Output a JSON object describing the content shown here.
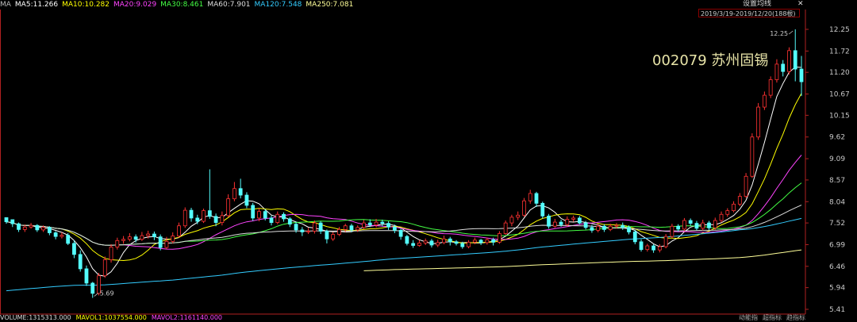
{
  "header": {
    "ma_indicators": [
      {
        "label": "MA",
        "color": "#bbbbbb"
      },
      {
        "label": "MA5:11.266",
        "color": "#ffffff"
      },
      {
        "label": "MA10:10.282",
        "color": "#ffff00"
      },
      {
        "label": "MA20:9.029",
        "color": "#ff44ff"
      },
      {
        "label": "MA30:8.461",
        "color": "#44ff44"
      },
      {
        "label": "MA60:7.901",
        "color": "#dddddd"
      },
      {
        "label": "MA120:7.548",
        "color": "#33ccff"
      },
      {
        "label": "MA250:7.081",
        "color": "#ffff99"
      }
    ],
    "settings_label": "设置均线",
    "range_label": "2019/3/19-2019/12/20(188根)"
  },
  "stock_label": "002079 苏州固锡",
  "volume_bar": [
    {
      "label": "VOLUME:1315313.000",
      "color": "#dddddd"
    },
    {
      "label": "MAVOL1:1037554.000",
      "color": "#ffff00"
    },
    {
      "label": "MAVOL2:1161140.000",
      "color": "#ff44ff"
    }
  ],
  "bottom_tabs": [
    "动能指",
    "超指标",
    "趋指标"
  ],
  "colors": {
    "up": "#ff3232",
    "down": "#54fcfc",
    "axis": "#b02020"
  },
  "chart_data": {
    "type": "candlestick",
    "y_ticks": [
      "12.25",
      "11.72",
      "11.20",
      "10.67",
      "10.15",
      "9.62",
      "9.09",
      "8.57",
      "8.04",
      "7.52",
      "6.99",
      "6.46",
      "5.94",
      "5.41"
    ],
    "ylim": [
      5.41,
      12.25
    ],
    "annotations": {
      "high": "12.25",
      "low": "5.69"
    },
    "candles": [
      [
        7.65,
        7.55,
        7.62,
        7.5
      ],
      [
        7.6,
        7.5,
        7.58,
        7.42
      ],
      [
        7.5,
        7.36,
        7.53,
        7.3
      ],
      [
        7.36,
        7.42,
        7.48,
        7.3
      ],
      [
        7.42,
        7.46,
        7.52,
        7.38
      ],
      [
        7.46,
        7.35,
        7.49,
        7.3
      ],
      [
        7.35,
        7.41,
        7.46,
        7.3
      ],
      [
        7.41,
        7.28,
        7.44,
        7.22
      ],
      [
        7.28,
        7.19,
        7.32,
        7.12
      ],
      [
        7.19,
        7.22,
        7.29,
        7.14
      ],
      [
        7.22,
        7.02,
        7.27,
        6.98
      ],
      [
        7.02,
        6.75,
        7.09,
        6.66
      ],
      [
        6.75,
        6.4,
        6.85,
        6.33
      ],
      [
        6.4,
        6.05,
        6.48,
        5.98
      ],
      [
        6.05,
        5.8,
        6.08,
        5.69
      ],
      [
        5.8,
        6.23,
        6.3,
        5.75
      ],
      [
        6.23,
        6.62,
        6.7,
        6.18
      ],
      [
        6.62,
        6.93,
        7.0,
        6.55
      ],
      [
        6.93,
        7.09,
        7.16,
        6.87
      ],
      [
        7.09,
        7.12,
        7.2,
        7.01
      ],
      [
        7.12,
        7.18,
        7.27,
        7.07
      ],
      [
        7.18,
        7.12,
        7.24,
        7.04
      ],
      [
        7.12,
        7.21,
        7.3,
        7.08
      ],
      [
        7.21,
        7.25,
        7.33,
        7.14
      ],
      [
        7.25,
        7.18,
        7.31,
        7.1
      ],
      [
        7.18,
        6.92,
        7.24,
        6.85
      ],
      [
        6.92,
        7.07,
        7.18,
        6.88
      ],
      [
        7.07,
        7.2,
        7.29,
        7.02
      ],
      [
        7.2,
        7.45,
        7.53,
        7.16
      ],
      [
        7.45,
        7.83,
        7.9,
        7.4
      ],
      [
        7.83,
        7.64,
        7.89,
        7.55
      ],
      [
        7.64,
        7.56,
        7.72,
        7.49
      ],
      [
        7.56,
        7.82,
        7.87,
        7.52
      ],
      [
        7.82,
        7.68,
        8.83,
        7.62
      ],
      [
        7.68,
        7.53,
        7.75,
        7.44
      ],
      [
        7.53,
        7.7,
        7.8,
        7.46
      ],
      [
        7.7,
        8.11,
        8.22,
        7.66
      ],
      [
        8.11,
        8.36,
        8.52,
        8.05
      ],
      [
        8.36,
        8.2,
        8.6,
        8.12
      ],
      [
        8.2,
        7.95,
        8.27,
        7.88
      ],
      [
        7.95,
        7.64,
        8.01,
        7.57
      ],
      [
        7.64,
        7.8,
        7.88,
        7.56
      ],
      [
        7.8,
        7.64,
        7.86,
        7.58
      ],
      [
        7.64,
        7.53,
        7.7,
        7.46
      ],
      [
        7.53,
        7.73,
        7.8,
        7.49
      ],
      [
        7.73,
        7.62,
        7.78,
        7.55
      ],
      [
        7.62,
        7.49,
        7.66,
        7.42
      ],
      [
        7.49,
        7.35,
        7.55,
        7.28
      ],
      [
        7.35,
        7.3,
        7.42,
        7.2
      ],
      [
        7.3,
        7.32,
        7.4,
        7.25
      ],
      [
        7.32,
        7.52,
        7.58,
        7.26
      ],
      [
        7.52,
        7.32,
        7.56,
        7.25
      ],
      [
        7.32,
        7.13,
        7.36,
        7.02
      ],
      [
        7.13,
        7.24,
        7.3,
        7.08
      ],
      [
        7.24,
        7.36,
        7.42,
        7.2
      ],
      [
        7.36,
        7.45,
        7.5,
        7.3
      ],
      [
        7.45,
        7.35,
        7.5,
        7.3
      ],
      [
        7.35,
        7.41,
        7.46,
        7.3
      ],
      [
        7.41,
        7.52,
        7.59,
        7.37
      ],
      [
        7.52,
        7.47,
        7.61,
        7.42
      ],
      [
        7.47,
        7.54,
        7.62,
        7.41
      ],
      [
        7.54,
        7.51,
        7.6,
        7.44
      ],
      [
        7.51,
        7.42,
        7.56,
        7.35
      ],
      [
        7.42,
        7.34,
        7.48,
        7.27
      ],
      [
        7.34,
        7.19,
        7.38,
        7.11
      ],
      [
        7.19,
        7.02,
        7.23,
        6.97
      ],
      [
        7.02,
        6.97,
        7.1,
        6.91
      ],
      [
        6.97,
        7.03,
        7.1,
        6.94
      ],
      [
        7.03,
        7.08,
        7.14,
        6.98
      ],
      [
        7.08,
        6.98,
        7.13,
        6.92
      ],
      [
        6.98,
        7.04,
        7.11,
        6.93
      ],
      [
        7.04,
        7.13,
        7.21,
        7.0
      ],
      [
        7.13,
        7.06,
        7.18,
        6.97
      ],
      [
        7.06,
        7.02,
        7.1,
        6.97
      ],
      [
        7.02,
        6.94,
        7.06,
        6.89
      ],
      [
        6.94,
        7.05,
        7.1,
        6.9
      ],
      [
        7.05,
        7.1,
        7.16,
        7.0
      ],
      [
        7.1,
        7.04,
        7.13,
        6.98
      ],
      [
        7.04,
        7.11,
        7.16,
        6.99
      ],
      [
        7.11,
        7.05,
        7.16,
        6.97
      ],
      [
        7.05,
        7.26,
        7.32,
        7.01
      ],
      [
        7.26,
        7.52,
        7.58,
        7.23
      ],
      [
        7.52,
        7.66,
        7.72,
        7.44
      ],
      [
        7.66,
        7.71,
        7.8,
        7.59
      ],
      [
        7.71,
        8.06,
        8.13,
        7.67
      ],
      [
        8.06,
        8.24,
        8.33,
        7.99
      ],
      [
        8.24,
        8.0,
        8.28,
        7.91
      ],
      [
        8.0,
        7.69,
        8.04,
        7.63
      ],
      [
        7.69,
        7.44,
        7.74,
        7.38
      ],
      [
        7.44,
        7.54,
        7.62,
        7.4
      ],
      [
        7.54,
        7.48,
        7.6,
        7.43
      ],
      [
        7.48,
        7.61,
        7.68,
        7.43
      ],
      [
        7.61,
        7.64,
        7.7,
        7.55
      ],
      [
        7.64,
        7.52,
        7.69,
        7.48
      ],
      [
        7.52,
        7.41,
        7.57,
        7.36
      ],
      [
        7.41,
        7.34,
        7.47,
        7.28
      ],
      [
        7.34,
        7.44,
        7.5,
        7.29
      ],
      [
        7.44,
        7.36,
        7.49,
        7.3
      ],
      [
        7.36,
        7.44,
        7.5,
        7.32
      ],
      [
        7.44,
        7.46,
        7.52,
        7.38
      ],
      [
        7.46,
        7.41,
        7.53,
        7.35
      ],
      [
        7.41,
        7.3,
        7.46,
        7.24
      ],
      [
        7.3,
        7.06,
        7.35,
        7.0
      ],
      [
        7.06,
        6.87,
        7.12,
        6.82
      ],
      [
        6.87,
        6.96,
        7.01,
        6.82
      ],
      [
        6.96,
        6.86,
        7.0,
        6.79
      ],
      [
        6.86,
        6.94,
        7.0,
        6.8
      ],
      [
        6.94,
        7.19,
        7.25,
        6.9
      ],
      [
        7.19,
        7.44,
        7.5,
        7.15
      ],
      [
        7.44,
        7.37,
        7.49,
        7.31
      ],
      [
        7.37,
        7.58,
        7.64,
        7.32
      ],
      [
        7.58,
        7.51,
        7.63,
        7.45
      ],
      [
        7.51,
        7.39,
        7.57,
        7.34
      ],
      [
        7.39,
        7.52,
        7.6,
        7.34
      ],
      [
        7.52,
        7.4,
        7.57,
        7.35
      ],
      [
        7.4,
        7.58,
        7.65,
        7.35
      ],
      [
        7.58,
        7.73,
        7.8,
        7.53
      ],
      [
        7.73,
        7.82,
        7.88,
        7.67
      ],
      [
        7.82,
        7.98,
        8.05,
        7.78
      ],
      [
        7.98,
        8.17,
        8.25,
        7.93
      ],
      [
        8.17,
        8.66,
        8.74,
        8.13
      ],
      [
        8.66,
        9.62,
        9.71,
        8.62
      ],
      [
        9.62,
        10.35,
        10.45,
        9.55
      ],
      [
        10.35,
        10.64,
        10.73,
        10.28
      ],
      [
        10.64,
        11.02,
        11.1,
        10.57
      ],
      [
        11.02,
        11.4,
        11.52,
        10.95
      ],
      [
        11.4,
        11.22,
        11.5,
        11.1
      ],
      [
        11.22,
        11.73,
        11.81,
        11.15
      ],
      [
        11.73,
        11.28,
        12.25,
        10.98
      ],
      [
        11.28,
        10.97,
        11.6,
        10.62
      ]
    ],
    "series": [
      {
        "name": "MA5",
        "color": "#ffffff"
      },
      {
        "name": "MA10",
        "color": "#ffff00"
      },
      {
        "name": "MA20",
        "color": "#ff44ff"
      },
      {
        "name": "MA30",
        "color": "#44ff44"
      },
      {
        "name": "MA60",
        "color": "#dddddd"
      },
      {
        "name": "MA120",
        "color": "#33ccff"
      },
      {
        "name": "MA250",
        "color": "#ffff99"
      }
    ]
  }
}
